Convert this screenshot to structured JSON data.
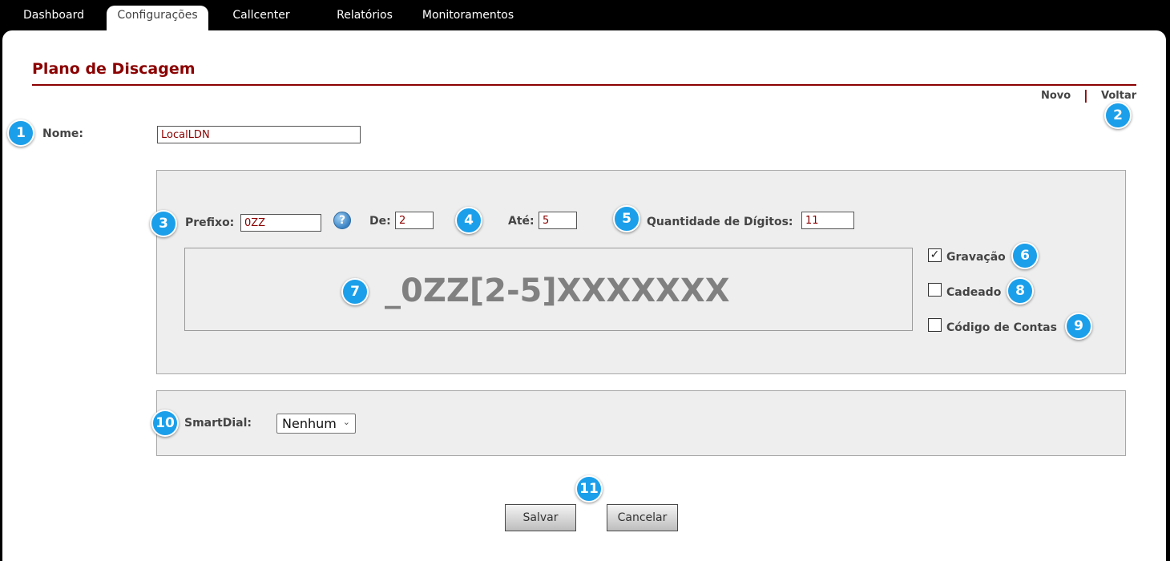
{
  "nav": {
    "tabs": [
      {
        "label": "Dashboard",
        "active": false
      },
      {
        "label": "Configurações",
        "active": true
      },
      {
        "label": "Callcenter",
        "active": false
      },
      {
        "label": "Relatórios",
        "active": false
      },
      {
        "label": "Monitoramentos",
        "active": false
      }
    ]
  },
  "page": {
    "title": "Plano de Discagem",
    "links": {
      "novo": "Novo",
      "separator": "|",
      "voltar": "Voltar"
    }
  },
  "form": {
    "nome_label": "Nome:",
    "nome_value": "LocalLDN",
    "prefixo_label": "Prefixo:",
    "prefixo_value": "0ZZ",
    "help_glyph": "?",
    "de_label": "De:",
    "de_value": "2",
    "ate_label": "Até:",
    "ate_value": "5",
    "qtd_label": "Quantidade de Dígitos:",
    "qtd_value": "11",
    "pattern": "_0ZZ[2-5]XXXXXXX",
    "gravacao_label": "Gravação",
    "gravacao_checked": true,
    "cadeado_label": "Cadeado",
    "cadeado_checked": false,
    "codigo_label": "Código de Contas",
    "codigo_checked": false,
    "smartdial_label": "SmartDial:",
    "smartdial_value": "Nenhum",
    "salvar_label": "Salvar",
    "cancelar_label": "Cancelar"
  },
  "callouts": [
    "1",
    "2",
    "3",
    "4",
    "5",
    "6",
    "7",
    "8",
    "9",
    "10",
    "11"
  ],
  "colors": {
    "accent": "#8b0000",
    "badge": "#1b9fea",
    "panel_bg": "#eeeeee"
  }
}
